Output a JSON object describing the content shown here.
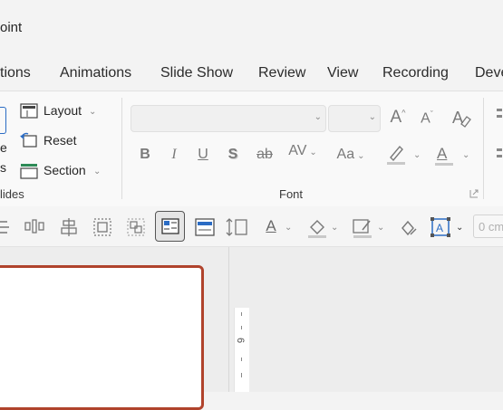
{
  "app": {
    "title": "oint"
  },
  "tabs": [
    "tions",
    "Animations",
    "Slide Show",
    "Review",
    "View",
    "Recording",
    "Deve"
  ],
  "ribbon": {
    "slides_group": {
      "layout_label": "Layout",
      "reset_label": "Reset",
      "section_label": "Section",
      "partial_e": "e",
      "partial_s": "s",
      "group_label": "lides"
    },
    "font_group": {
      "group_label": "Font",
      "bold": "B",
      "italic": "I",
      "underline": "U",
      "shadow": "S",
      "strike": "ab",
      "spacing": "AV",
      "case": "Aa",
      "grow": "A",
      "shrink": "A",
      "font_color_letter": "A"
    }
  },
  "toolbar2": {
    "shape_width_placeholder": "0 cm"
  },
  "ruler": {
    "label": "6"
  },
  "icons": [
    "layout-icon",
    "reset-icon",
    "section-icon",
    "clear-format-icon",
    "highlight-icon",
    "font-color-icon",
    "dialog-launcher-icon",
    "align-icon",
    "distribute-icon",
    "text-box-icon",
    "fill-icon",
    "outline-icon",
    "effects-icon"
  ]
}
